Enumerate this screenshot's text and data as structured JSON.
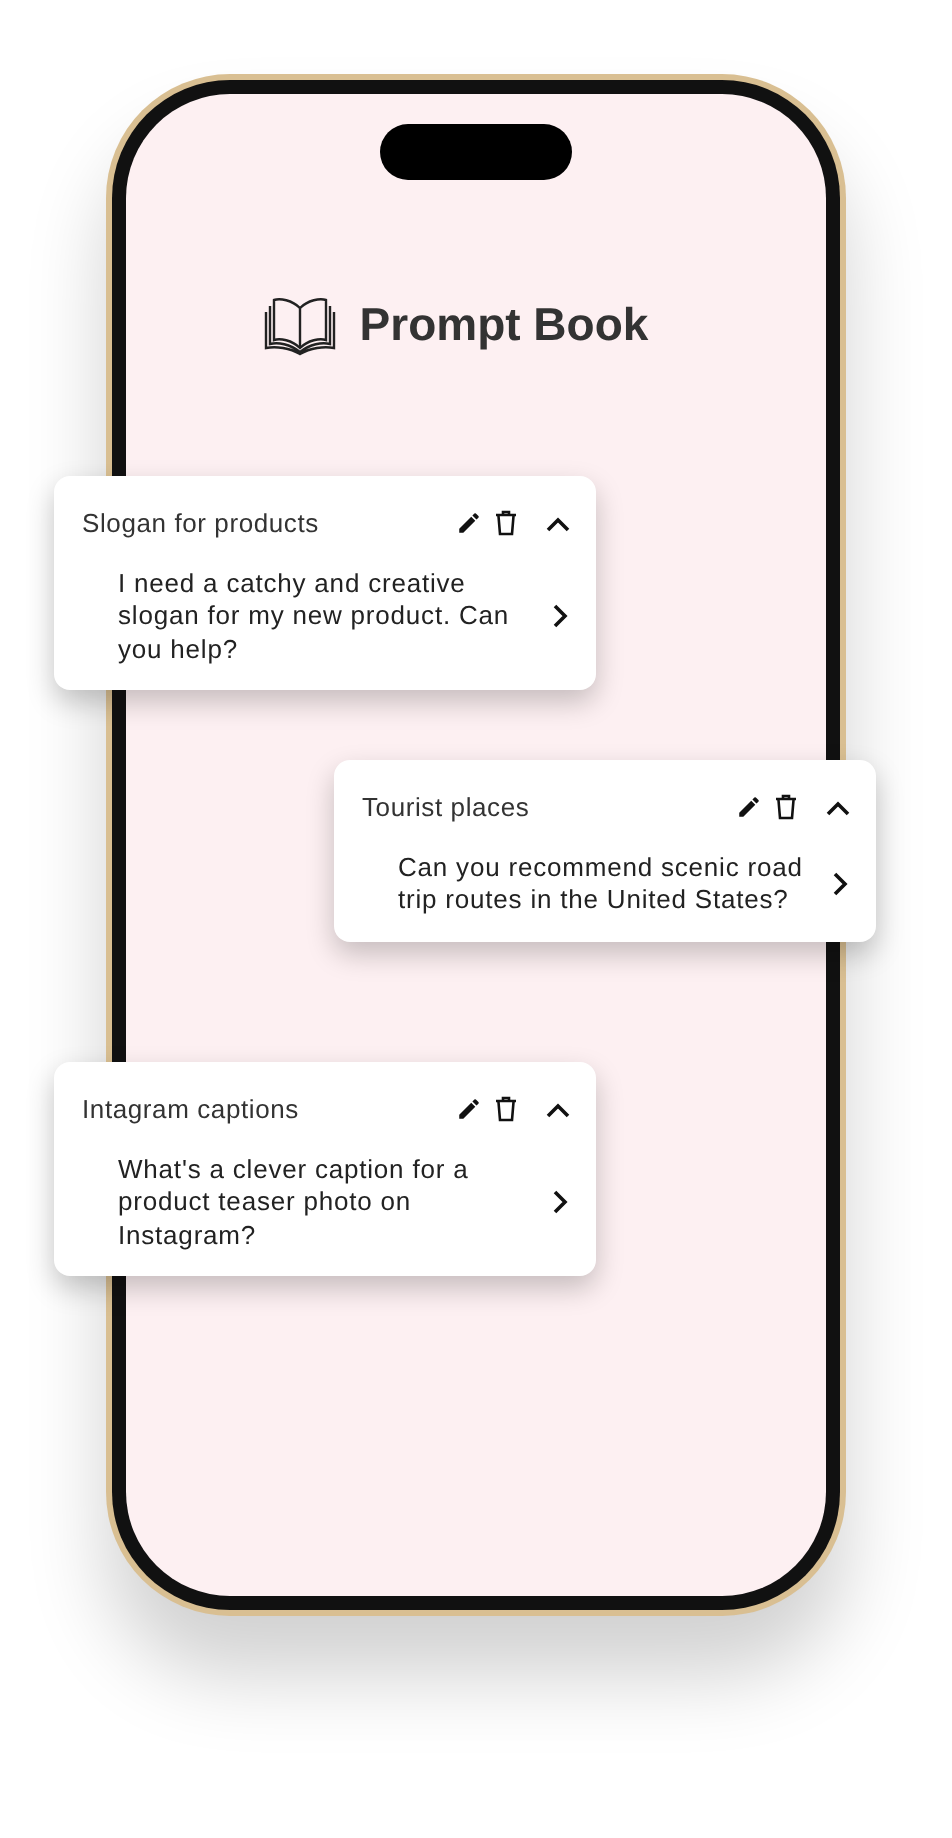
{
  "app": {
    "title": "Prompt Book"
  },
  "prompts": [
    {
      "title": "Slogan for products",
      "text": "I need a catchy and creative slogan for my new product. Can you help?",
      "expanded": true
    },
    {
      "title": "Tourist places",
      "text": "Can you recommend scenic road trip routes in the United States?",
      "expanded": true
    },
    {
      "title": "Intagram captions",
      "text": "What's a clever caption for a product teaser photo on Instagram?",
      "expanded": true
    }
  ]
}
